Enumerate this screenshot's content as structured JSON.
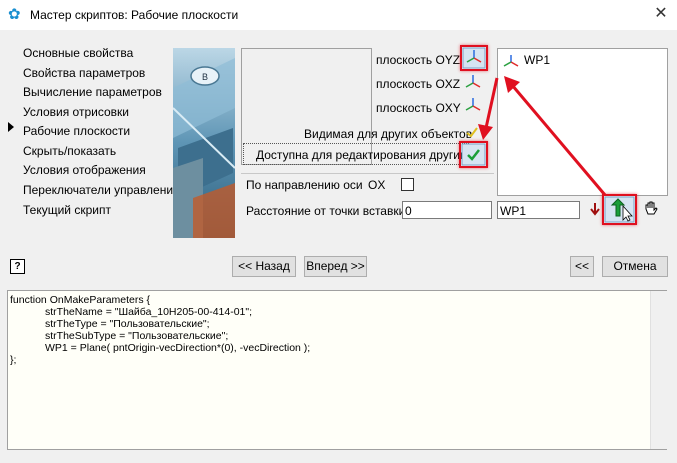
{
  "window": {
    "title": "Мастер скриптов:  Рабочие плоскости",
    "close_glyph": "✕",
    "icon": "gear-icon"
  },
  "sidebar": {
    "items": [
      {
        "label": "Основные свойства"
      },
      {
        "label": "Свойства параметров"
      },
      {
        "label": "Вычисление параметров"
      },
      {
        "label": "Условия отрисовки"
      },
      {
        "label": "Рабочие плоскости"
      },
      {
        "label": "Скрыть/показать"
      },
      {
        "label": "Условия отображения"
      },
      {
        "label": "Переключатели управления"
      },
      {
        "label": "Текущий скрипт"
      }
    ],
    "active_index": 4
  },
  "planes": {
    "oyz": "плоскость OYZ",
    "oxz": "плоскость OXZ",
    "oxy": "плоскость OXY"
  },
  "options": {
    "visible_label": "Видимая для других объектов",
    "editable_label": "Доступна для редактирования другими"
  },
  "workplanes_list": [
    {
      "label": "WP1"
    }
  ],
  "direction": {
    "label": "По направлению оси",
    "axis": "OX"
  },
  "distance": {
    "label": "Расстояние от точки вставки:",
    "value": "0"
  },
  "name_input": {
    "value": "WP1"
  },
  "buttons": {
    "back": "<< Назад",
    "forward": "Вперед >>",
    "collapse": "<<",
    "cancel": "Отмена"
  },
  "help_glyph": "?",
  "code": {
    "lines": [
      "function OnMakeParameters {",
      "            strTheName = \"Шайба_10Н205-00-414-01\";",
      "            strTheType = \"Пользовательские\";",
      "            strTheSubType = \"Пользовательские\";",
      "            WP1 = Plane( pntOrigin-vecDirection*(0), -vecDirection );",
      "};"
    ]
  },
  "colors": {
    "accent_red": "#e01020",
    "check_green": "#1a9e3a",
    "background": "#f0f0f0"
  }
}
